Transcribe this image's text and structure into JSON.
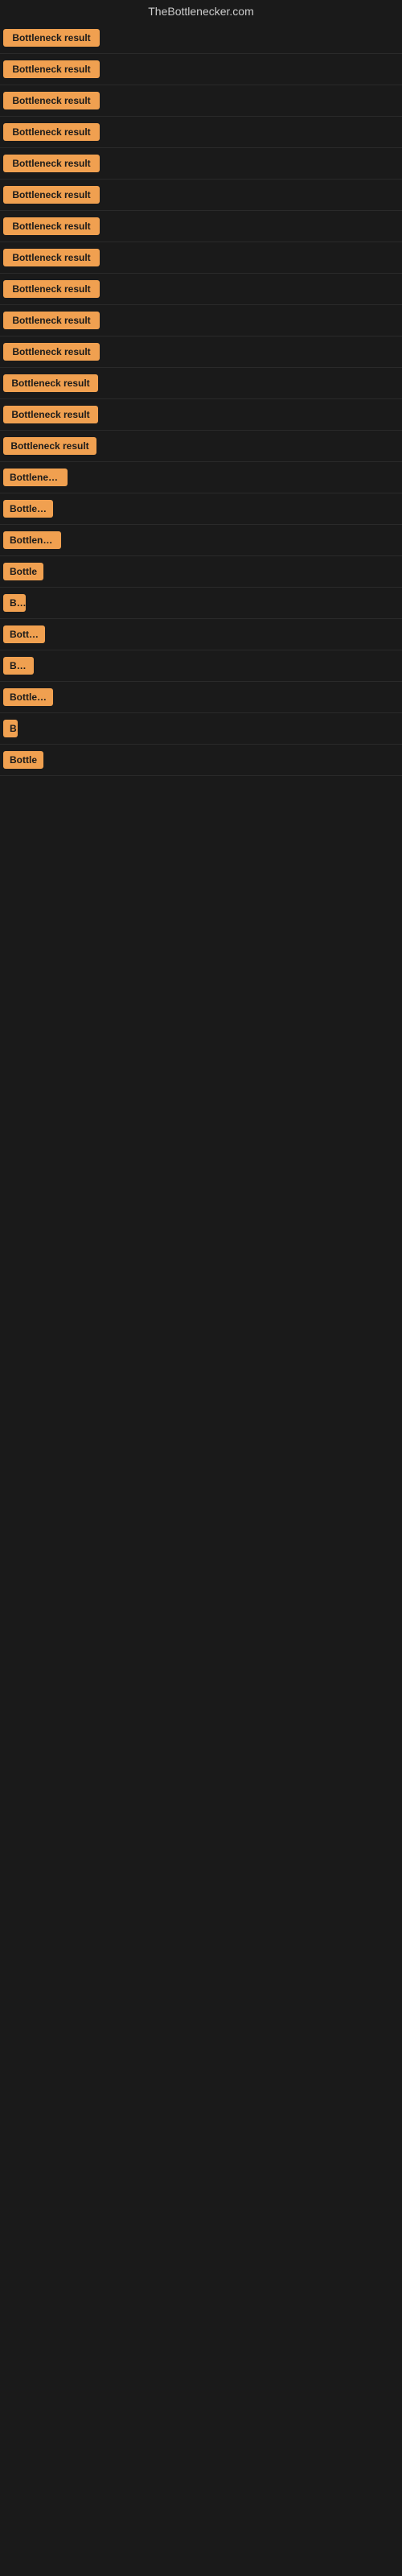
{
  "site": {
    "title": "TheBottlenecker.com"
  },
  "rows": [
    {
      "id": 1,
      "label": "Bottleneck result",
      "button_width": 120
    },
    {
      "id": 2,
      "label": "Bottleneck result",
      "button_width": 120
    },
    {
      "id": 3,
      "label": "Bottleneck result",
      "button_width": 120
    },
    {
      "id": 4,
      "label": "Bottleneck result",
      "button_width": 120
    },
    {
      "id": 5,
      "label": "Bottleneck result",
      "button_width": 120
    },
    {
      "id": 6,
      "label": "Bottleneck result",
      "button_width": 120
    },
    {
      "id": 7,
      "label": "Bottleneck result",
      "button_width": 120
    },
    {
      "id": 8,
      "label": "Bottleneck result",
      "button_width": 120
    },
    {
      "id": 9,
      "label": "Bottleneck result",
      "button_width": 120
    },
    {
      "id": 10,
      "label": "Bottleneck result",
      "button_width": 120
    },
    {
      "id": 11,
      "label": "Bottleneck result",
      "button_width": 120
    },
    {
      "id": 12,
      "label": "Bottleneck result",
      "button_width": 118
    },
    {
      "id": 13,
      "label": "Bottleneck result",
      "button_width": 118
    },
    {
      "id": 14,
      "label": "Bottleneck result",
      "button_width": 116
    },
    {
      "id": 15,
      "label": "Bottleneck r",
      "button_width": 80
    },
    {
      "id": 16,
      "label": "Bottlene",
      "button_width": 62
    },
    {
      "id": 17,
      "label": "Bottleneck",
      "button_width": 72
    },
    {
      "id": 18,
      "label": "Bottle",
      "button_width": 50
    },
    {
      "id": 19,
      "label": "Bo",
      "button_width": 28
    },
    {
      "id": 20,
      "label": "Bottler",
      "button_width": 52
    },
    {
      "id": 21,
      "label": "Bott",
      "button_width": 38
    },
    {
      "id": 22,
      "label": "Bottlene",
      "button_width": 62
    },
    {
      "id": 23,
      "label": "B",
      "button_width": 18
    },
    {
      "id": 24,
      "label": "Bottle",
      "button_width": 50
    }
  ],
  "colors": {
    "button_bg": "#f0a050",
    "page_bg": "#1a1a1a",
    "title_color": "#cccccc",
    "button_text": "#1a1a1a"
  }
}
